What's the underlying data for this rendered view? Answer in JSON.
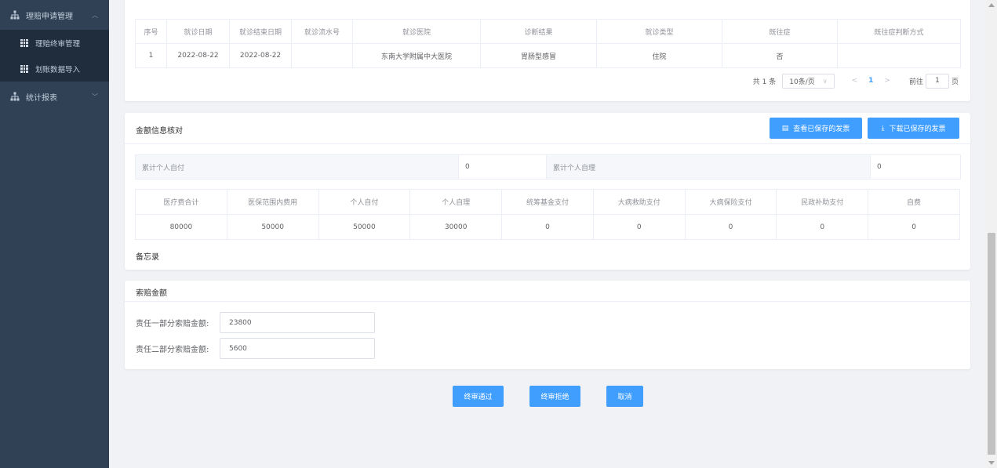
{
  "sidebar": {
    "group1": {
      "label": "理赔申请管理",
      "icon": "sitemap-icon",
      "chevron": "︿"
    },
    "items": [
      {
        "label": "理赔终审管理",
        "icon": "table-icon"
      },
      {
        "label": "划账数据导入",
        "icon": "table-icon"
      }
    ],
    "group2": {
      "label": "统计报表",
      "icon": "sitemap-icon",
      "chevron": "﹀"
    }
  },
  "visits": {
    "columns": [
      "序号",
      "就诊日期",
      "就诊结束日期",
      "就诊流水号",
      "就诊医院",
      "诊断结果",
      "就诊类型",
      "既往症",
      "既往症判断方式"
    ],
    "rows": [
      [
        "1",
        "2022-08-22",
        "2022-08-22",
        "",
        "东南大学附属中大医院",
        "胃肠型感冒",
        "住院",
        "否",
        ""
      ]
    ]
  },
  "pager": {
    "total": "共 1 条",
    "page_size": "10条/页",
    "prev": "<",
    "page": "1",
    "next": ">",
    "goto_prefix": "前往",
    "goto_value": "1",
    "goto_suffix": "页"
  },
  "amount": {
    "title": "金额信息核对",
    "btn_view": "查看已保存的发票",
    "btn_download": "下载已保存的发票",
    "summary": {
      "label1": "累计个人自付",
      "value1": "0",
      "label2": "累计个人自理",
      "value2": "0"
    },
    "columns": [
      "医疗费合计",
      "医保范围内费用",
      "个人自付",
      "个人自理",
      "统筹基金支付",
      "大病救助支付",
      "大病保险支付",
      "民政补助支付",
      "自费"
    ],
    "values": [
      "80000",
      "50000",
      "50000",
      "30000",
      "0",
      "0",
      "0",
      "0",
      "0"
    ],
    "memo_label": "备忘录"
  },
  "claim": {
    "title": "索赔金额",
    "field1_label": "责任一部分索赔金额:",
    "field1_value": "23800",
    "field2_label": "责任二部分索赔金额:",
    "field2_value": "5600"
  },
  "actions": {
    "approve": "终审通过",
    "reject": "终审拒绝",
    "cancel": "取消"
  },
  "colors": {
    "sidebar_bg": "#304156",
    "submenu_bg": "#1f2d3d",
    "primary": "#409eff",
    "page_bg": "#f0f2f5"
  }
}
